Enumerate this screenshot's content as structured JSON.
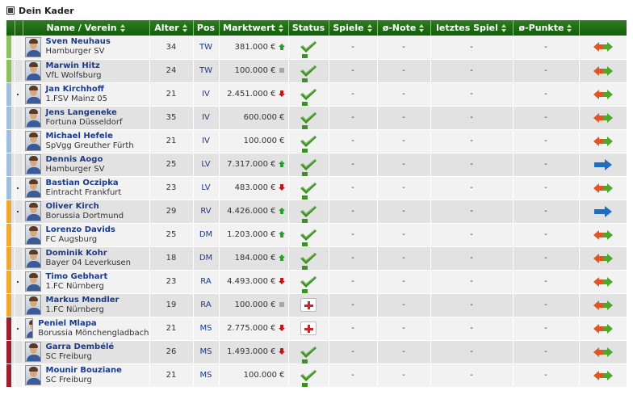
{
  "header": {
    "title": "Dein Kader"
  },
  "columns": [
    "Name / Verein",
    "Alter",
    "Pos",
    "Marktwert",
    "Status",
    "Spiele",
    "ø-Note",
    "letztes Spiel",
    "ø-Punkte"
  ],
  "colors": {
    "TW": "#8cc05c",
    "IV": "#9fbfdc",
    "LV": "#9fbfdc",
    "RV": "#f0a830",
    "DM": "#f0a830",
    "RA": "#f0a830",
    "MS": "#9a2030",
    "header_green": "#1e6e14",
    "link_blue": "#1a3a8a"
  },
  "players": [
    {
      "name": "Sven Neuhaus",
      "club": "Hamburger SV",
      "age": "34",
      "pos": "TW",
      "value": "381.000 €",
      "trend": "up",
      "status": "fit",
      "games": "-",
      "note": "-",
      "last": "-",
      "points": "-",
      "action": "swap",
      "dot": false
    },
    {
      "name": "Marwin Hitz",
      "club": "VfL Wolfsburg",
      "age": "24",
      "pos": "TW",
      "value": "100.000 €",
      "trend": "same",
      "status": "fit",
      "games": "-",
      "note": "-",
      "last": "-",
      "points": "-",
      "action": "swap",
      "dot": false
    },
    {
      "name": "Jan Kirchhoff",
      "club": "1.FSV Mainz 05",
      "age": "21",
      "pos": "IV",
      "value": "2.451.000 €",
      "trend": "down",
      "status": "fit",
      "games": "-",
      "note": "-",
      "last": "-",
      "points": "-",
      "action": "swap",
      "dot": true
    },
    {
      "name": "Jens Langeneke",
      "club": "Fortuna Düsseldorf",
      "age": "35",
      "pos": "IV",
      "value": "600.000 €",
      "trend": "none",
      "status": "fit",
      "games": "-",
      "note": "-",
      "last": "-",
      "points": "-",
      "action": "swap",
      "dot": false
    },
    {
      "name": "Michael Hefele",
      "club": "SpVgg Greuther Fürth",
      "age": "21",
      "pos": "IV",
      "value": "100.000 €",
      "trend": "none",
      "status": "fit",
      "games": "-",
      "note": "-",
      "last": "-",
      "points": "-",
      "action": "swap",
      "dot": false
    },
    {
      "name": "Dennis Aogo",
      "club": "Hamburger SV",
      "age": "25",
      "pos": "LV",
      "value": "7.317.000 €",
      "trend": "up",
      "status": "fit",
      "games": "-",
      "note": "-",
      "last": "-",
      "points": "-",
      "action": "right",
      "dot": false
    },
    {
      "name": "Bastian Oczipka",
      "club": "Eintracht Frankfurt",
      "age": "23",
      "pos": "LV",
      "value": "483.000 €",
      "trend": "down",
      "status": "fit",
      "games": "-",
      "note": "-",
      "last": "-",
      "points": "-",
      "action": "swap",
      "dot": true
    },
    {
      "name": "Oliver Kirch",
      "club": "Borussia Dortmund",
      "age": "29",
      "pos": "RV",
      "value": "4.426.000 €",
      "trend": "up",
      "status": "fit",
      "games": "-",
      "note": "-",
      "last": "-",
      "points": "-",
      "action": "right",
      "dot": true
    },
    {
      "name": "Lorenzo Davids",
      "club": "FC Augsburg",
      "age": "25",
      "pos": "DM",
      "value": "1.203.000 €",
      "trend": "up",
      "status": "fit",
      "games": "-",
      "note": "-",
      "last": "-",
      "points": "-",
      "action": "swap",
      "dot": false
    },
    {
      "name": "Dominik Kohr",
      "club": "Bayer 04 Leverkusen",
      "age": "18",
      "pos": "DM",
      "value": "184.000 €",
      "trend": "up",
      "status": "fit",
      "games": "-",
      "note": "-",
      "last": "-",
      "points": "-",
      "action": "swap",
      "dot": false
    },
    {
      "name": "Timo Gebhart",
      "club": "1.FC Nürnberg",
      "age": "23",
      "pos": "RA",
      "value": "4.493.000 €",
      "trend": "down",
      "status": "fit",
      "games": "-",
      "note": "-",
      "last": "-",
      "points": "-",
      "action": "swap",
      "dot": true
    },
    {
      "name": "Markus Mendler",
      "club": "1.FC Nürnberg",
      "age": "19",
      "pos": "RA",
      "value": "100.000 €",
      "trend": "same",
      "status": "injured",
      "games": "-",
      "note": "-",
      "last": "-",
      "points": "-",
      "action": "swap",
      "dot": false
    },
    {
      "name": "Peniel Mlapa",
      "club": "Borussia Mönchengladbach",
      "age": "21",
      "pos": "MS",
      "value": "2.775.000 €",
      "trend": "down",
      "status": "injured",
      "games": "-",
      "note": "-",
      "last": "-",
      "points": "-",
      "action": "swap",
      "dot": true
    },
    {
      "name": "Garra Dembélé",
      "club": "SC Freiburg",
      "age": "26",
      "pos": "MS",
      "value": "1.493.000 €",
      "trend": "down",
      "status": "fit",
      "games": "-",
      "note": "-",
      "last": "-",
      "points": "-",
      "action": "swap",
      "dot": false
    },
    {
      "name": "Mounir Bouziane",
      "club": "SC Freiburg",
      "age": "21",
      "pos": "MS",
      "value": "100.000 €",
      "trend": "none",
      "status": "fit",
      "games": "-",
      "note": "-",
      "last": "-",
      "points": "-",
      "action": "swap",
      "dot": false
    }
  ]
}
